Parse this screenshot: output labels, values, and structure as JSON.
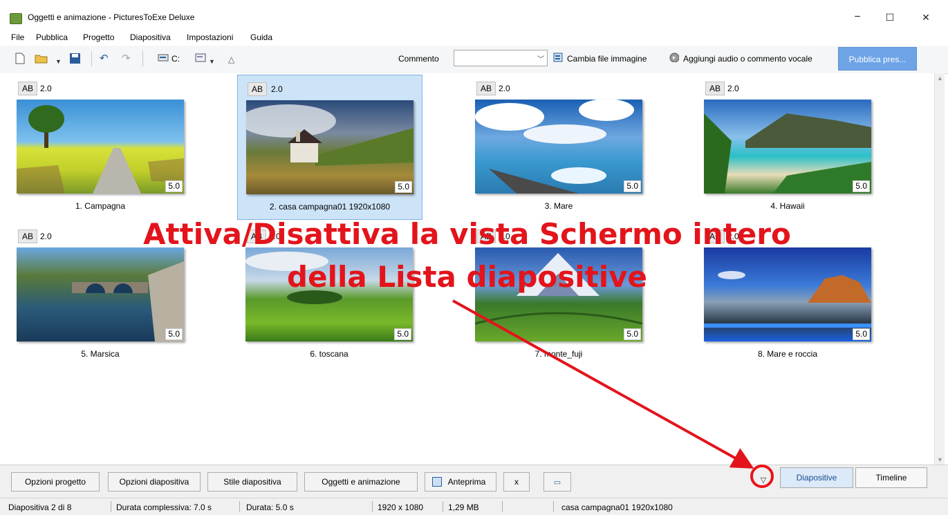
{
  "window": {
    "title": "Oggetti e animazione - PicturesToExe Deluxe",
    "minimize": "−",
    "maximize": "☐",
    "close": "✕"
  },
  "menu": [
    "File",
    "Pubblica",
    "Progetto",
    "Diapositiva",
    "Impostazioni",
    "Guida"
  ],
  "toolbar": {
    "drive_label": "C:",
    "comment_label": "Commento",
    "comment_value": "",
    "change_image": "Cambia file immagine",
    "add_audio": "Aggiungi audio o commento vocale",
    "publish": "Pubblica pres..."
  },
  "slides": [
    {
      "ab": "AB",
      "transition": "2.0",
      "duration": "5.0",
      "caption": "1. Campagna",
      "selected": false
    },
    {
      "ab": "AB",
      "transition": "2.0",
      "duration": "5.0",
      "caption": "2. casa campagna01 1920x1080",
      "selected": true
    },
    {
      "ab": "AB",
      "transition": "2.0",
      "duration": "5.0",
      "caption": "3. Mare",
      "selected": false
    },
    {
      "ab": "AB",
      "transition": "2.0",
      "duration": "5.0",
      "caption": "4. Hawaii",
      "selected": false
    },
    {
      "ab": "AB",
      "transition": "2.0",
      "duration": "5.0",
      "caption": "5. Marsica",
      "selected": false
    },
    {
      "ab": "AB",
      "transition": "2.0",
      "duration": "5.0",
      "caption": "6. toscana",
      "selected": false
    },
    {
      "ab": "AB",
      "transition": "2.0",
      "duration": "5.0",
      "caption": "7. monte_fuji",
      "selected": false
    },
    {
      "ab": "AB",
      "transition": "2.0",
      "duration": "5.0",
      "caption": "8. Mare e roccia",
      "selected": false
    }
  ],
  "annotation": {
    "line1": "Attiva/Disattiva la vista Schermo intero",
    "line2": "della Lista diapositive",
    "color": "#e3141b"
  },
  "bottom": {
    "project_options": "Opzioni progetto",
    "slide_options": "Opzioni diapositiva",
    "slide_style": "Stile diapositiva",
    "objects_animation": "Oggetti e animazione",
    "preview": "Anteprima",
    "close_x": "x",
    "toggle_glyph": "▽",
    "tab_slides": "Diapositive",
    "tab_timeline": "Timeline"
  },
  "status": {
    "slide_pos": "Diapositiva 2 di 8",
    "total_duration": "Durata complessiva: 7.0 s",
    "duration": "Durata: 5.0 s",
    "resolution": "1920 x 1080",
    "size": "1,29 MB",
    "filename": "casa campagna01 1920x1080"
  }
}
